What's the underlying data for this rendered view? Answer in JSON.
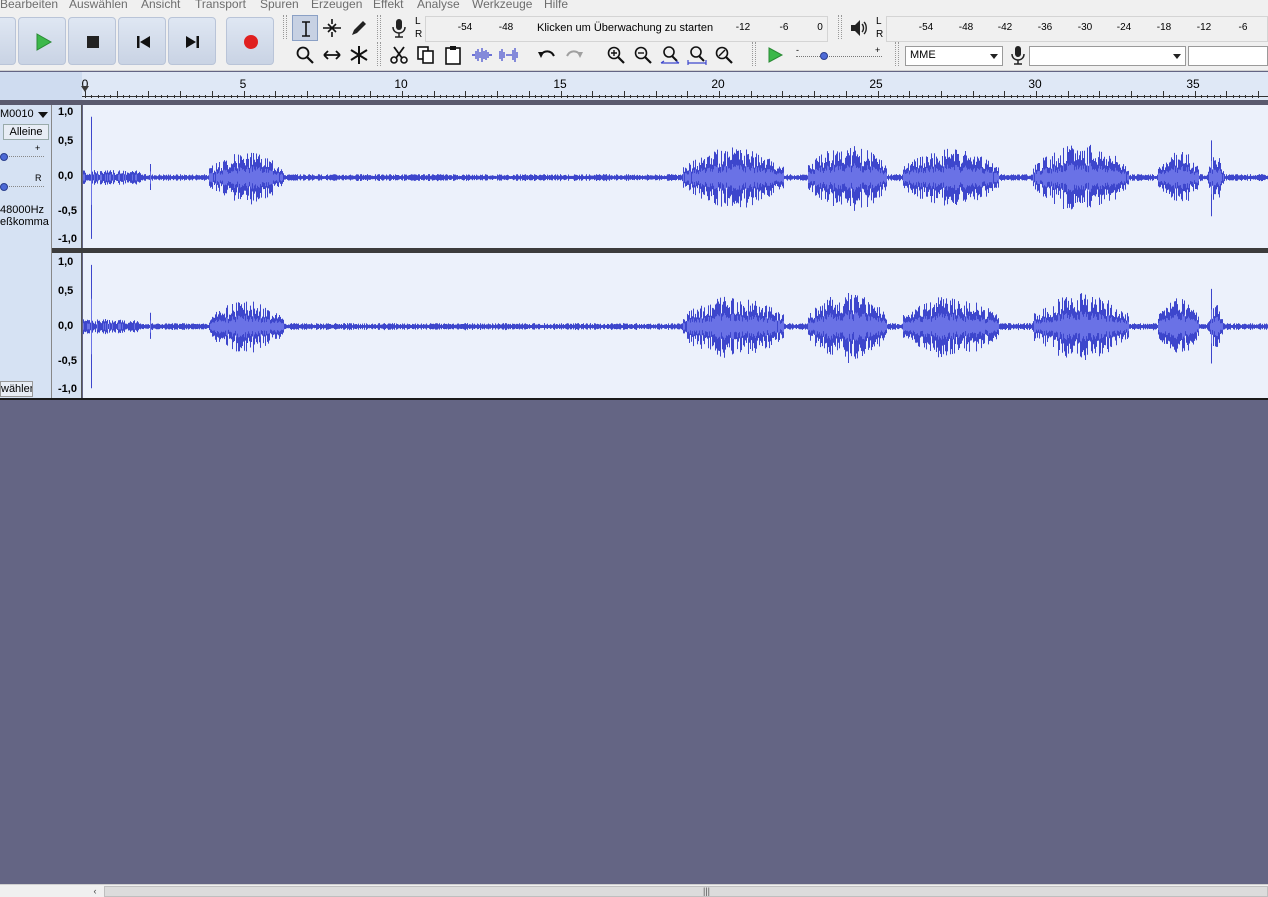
{
  "menu": [
    "Bearbeiten",
    "Auswählen",
    "Ansicht",
    "Transport",
    "Spuren",
    "Erzeugen",
    "Effekt",
    "Analyse",
    "Werkzeuge",
    "Hilfe"
  ],
  "colors": {
    "waveform": "#3d46cc",
    "waveform_rms": "#6a72e6",
    "play_icon": "#3cb84a",
    "record_icon": "#e02020",
    "background": "#646584"
  },
  "record_meter": {
    "lr_top": "L",
    "lr_bottom": "R",
    "ticks_left": [
      "-54",
      "-48"
    ],
    "monitor_text": "Klicken um Überwachung zu starten",
    "ticks_right": [
      "-12",
      "-6",
      "0"
    ]
  },
  "playback_meter": {
    "lr_top": "L",
    "lr_bottom": "R",
    "ticks": [
      "-54",
      "-48",
      "-42",
      "-36",
      "-30",
      "-24",
      "-18",
      "-12",
      "-6"
    ]
  },
  "speed_slider": {
    "minus": "-",
    "plus": "+"
  },
  "device": {
    "host": "MME",
    "input_device": "",
    "output_device": ""
  },
  "ruler": {
    "labels": [
      "0",
      "5",
      "10",
      "15",
      "20",
      "25",
      "30",
      "35"
    ]
  },
  "track": {
    "name": "M0010",
    "solo_label": "Alleine",
    "gain_plus": "+",
    "pan_right": "R",
    "rate": "48000Hz",
    "format": "eßkomma",
    "select_label": "wählen"
  },
  "vscale": [
    "1,0",
    "0,5",
    "0,0",
    "-0,5",
    "-1,0"
  ],
  "scrollbar": {
    "left_arrow": "‹",
    "grip": "|||"
  }
}
